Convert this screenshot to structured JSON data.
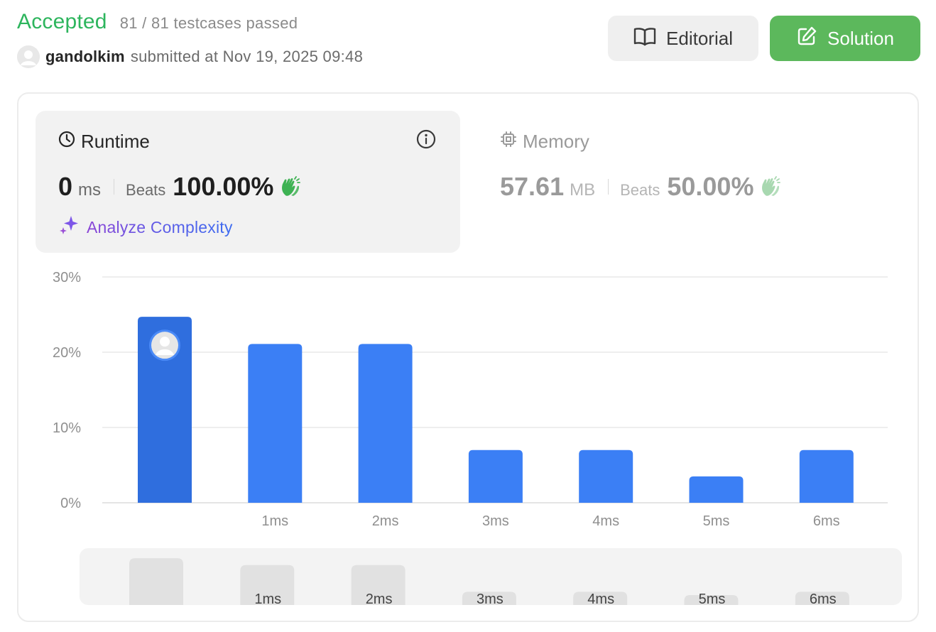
{
  "header": {
    "status": "Accepted",
    "testcases": "81 / 81 testcases passed",
    "submitter": "gandolkim",
    "submitted_meta": "submitted at Nov 19, 2025 09:48",
    "editorial_label": "Editorial",
    "solution_label": "Solution"
  },
  "runtime": {
    "title": "Runtime",
    "value": "0",
    "unit": "ms",
    "beats_label": "Beats",
    "beats": "100.00%",
    "analyze_label": "Analyze Complexity"
  },
  "memory": {
    "title": "Memory",
    "value": "57.61",
    "unit": "MB",
    "beats_label": "Beats",
    "beats": "50.00%"
  },
  "colors": {
    "accepted": "#2db55d",
    "bar": "#3b7ff5",
    "bar_selected": "#2f6ede",
    "solution_button": "#5cb85c",
    "hands_active": "#3eb253",
    "hands_muted": "#a8d8b0"
  },
  "icons": {
    "editorial": "book-open-icon",
    "solution": "edit-icon",
    "runtime": "clock-icon",
    "memory": "chip-icon",
    "info": "info-icon",
    "analyze": "sparkle-icon",
    "beats": "clapping-hands-icon"
  },
  "chart_data": {
    "type": "bar",
    "categories": [
      "",
      "1ms",
      "2ms",
      "3ms",
      "4ms",
      "5ms",
      "6ms"
    ],
    "values": [
      24.7,
      21.1,
      21.1,
      7.0,
      7.0,
      3.5,
      7.0
    ],
    "selected_index": 0,
    "yticks": [
      "0%",
      "10%",
      "20%",
      "30%"
    ],
    "ylim": [
      0,
      30
    ],
    "grid": true
  }
}
